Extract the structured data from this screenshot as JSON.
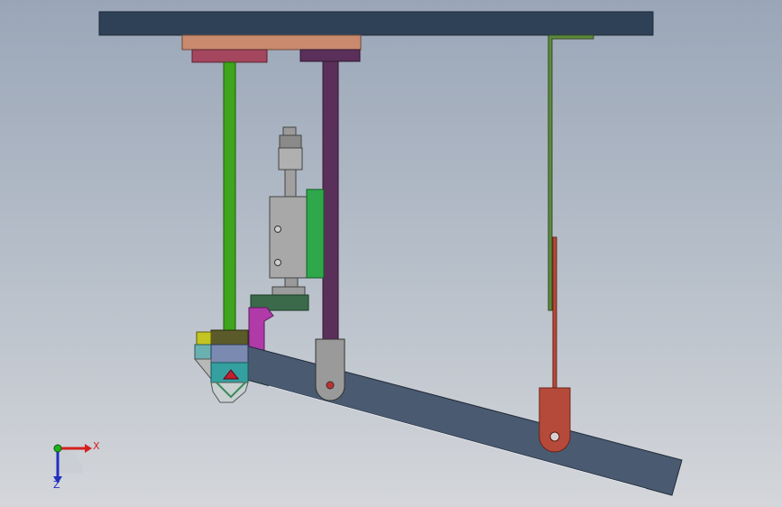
{
  "viewport": {
    "background_top": "#9aa6b8",
    "background_bottom": "#d4d6da"
  },
  "triad": {
    "x_label": "X",
    "z_label": "Z",
    "x_color": "#d42020",
    "y_color": "#20b020",
    "z_color": "#2030c0"
  },
  "parts": {
    "frame_color": "#2f4157",
    "left_rod_color": "#3fa51c",
    "right_rod_color": "#5a2f5a",
    "cylinder_color": "#a8a8a8",
    "bracket_color": "#2ea84a",
    "pin_rod_color": "#b54a3a",
    "thin_rod_color": "#5e8a3e",
    "lever_color": "#4a5a70",
    "mount_plate_color": "#c98a6e",
    "pin_block_color": "#a4465e"
  }
}
